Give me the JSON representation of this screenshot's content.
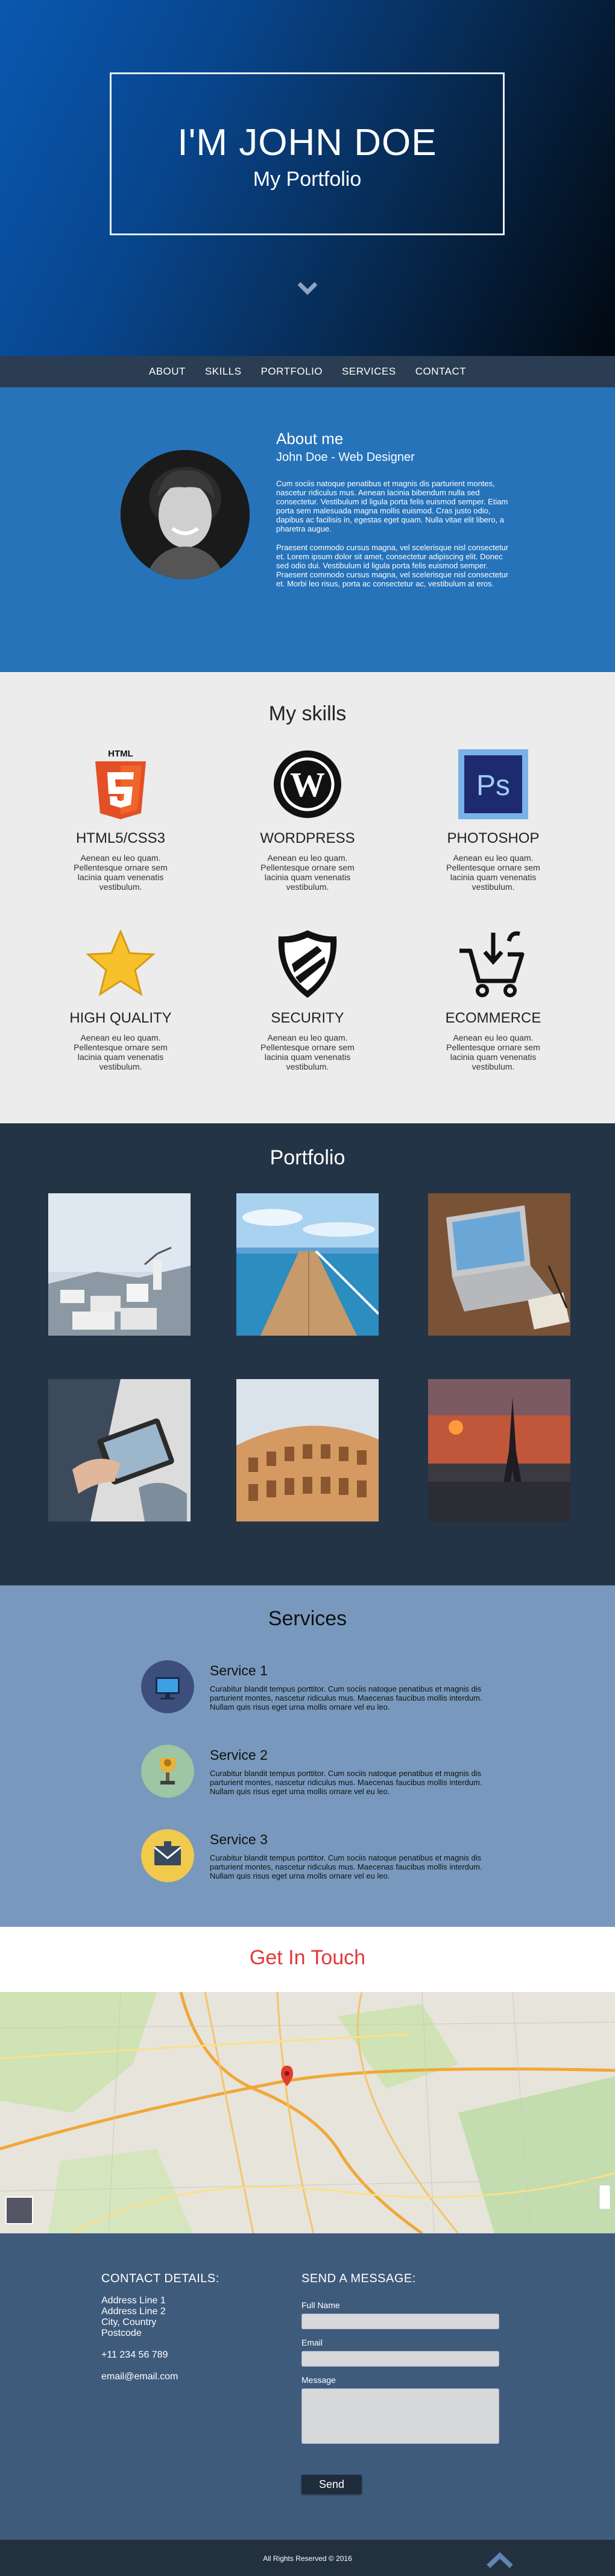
{
  "hero": {
    "title": "I'M JOHN DOE",
    "subtitle": "My Portfolio"
  },
  "nav": [
    "ABOUT",
    "SKILLS",
    "PORTFOLIO",
    "SERVICES",
    "CONTACT"
  ],
  "about": {
    "title": "About me",
    "role": "John Doe - Web Designer",
    "p1": "Cum sociis natoque penatibus et magnis dis parturient montes, nascetur ridiculus mus. Aenean lacinia bibendum nulla sed consectetur. Vestibulum id ligula porta felis euismod semper. Etiam porta sem malesuada magna mollis euismod. Cras justo odio, dapibus ac facilisis in, egestas eget quam. Nulla vitae elit libero, a pharetra augue.",
    "p2": "Praesent commodo cursus magna, vel scelerisque nisl consectetur et. Lorem ipsum dolor sit amet, consectetur adipiscing elit. Donec sed odio dui. Vestibulum id ligula porta felis euismod semper. Praesent commodo cursus magna, vel scelerisque nisl consectetur et. Morbi leo risus, porta ac consectetur ac, vestibulum at eros."
  },
  "skills": {
    "title": "My skills",
    "desc": "Aenean eu leo quam. Pellentesque ornare sem lacinia quam venenatis vestibulum.",
    "items": [
      {
        "name": "HTML5/CSS3",
        "icon": "html5-icon"
      },
      {
        "name": "WORDPRESS",
        "icon": "wordpress-icon"
      },
      {
        "name": "PHOTOSHOP",
        "icon": "photoshop-icon"
      },
      {
        "name": "HIGH QUALITY",
        "icon": "star-icon"
      },
      {
        "name": "SECURITY",
        "icon": "shield-icon"
      },
      {
        "name": "ECOMMERCE",
        "icon": "cart-icon"
      }
    ],
    "html5_badge": "HTML",
    "ps_badge": "Ps"
  },
  "portfolio": {
    "title": "Portfolio",
    "images": [
      "santorini",
      "pier",
      "laptop-desk",
      "tablet",
      "colosseum",
      "eiffel-tower"
    ]
  },
  "services": {
    "title": "Services",
    "desc": "Curabitur blandit tempus porttitor. Cum sociis natoque penatibus et magnis dis parturient montes, nascetur ridiculus mus. Maecenas faucibus mollis interdum. Nullam quis risus eget urna mollis ornare vel eu leo.",
    "items": [
      "Service 1",
      "Service 2",
      "Service 3"
    ]
  },
  "touch": {
    "title": "Get In Touch"
  },
  "contact": {
    "details_title": "CONTACT DETAILS:",
    "address": [
      "Address Line 1",
      "Address Line 2",
      "City, Country",
      "Postcode"
    ],
    "phone": "+11 234 56 789",
    "email": "email@email.com",
    "form_title": "SEND A MESSAGE:",
    "full_name_label": "Full Name",
    "email_label": "Email",
    "message_label": "Message",
    "send_label": "Send"
  },
  "footer": {
    "copyright": "All Rights Reserved © 2016"
  },
  "colors": {
    "about_bg": "#2673ba",
    "nav_bg": "#2a3d52",
    "touch": "#e0393b",
    "services_bg": "#7899bd"
  }
}
